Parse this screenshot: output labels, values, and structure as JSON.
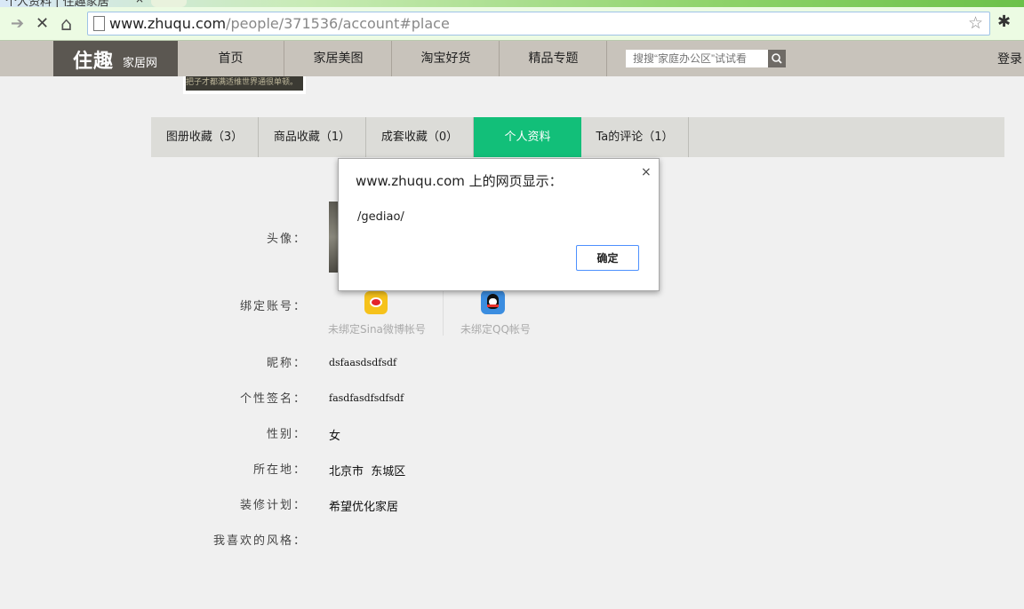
{
  "browser": {
    "tab_title": "个人资料 | 住趣家居",
    "tab_close": "×",
    "url_host": "www.zhuqu.com",
    "url_path": "/people/371536/account#place",
    "back_glyph": "➔",
    "stop_glyph": "✕",
    "home_glyph": "⌂",
    "star_glyph": "☆",
    "ext_glyph": "✱"
  },
  "header": {
    "logo_main": "住趣",
    "logo_sub": "家居网",
    "nav": [
      "首页",
      "家居美图",
      "淘宝好货",
      "精品专题"
    ],
    "search_placeholder": "搜搜“家庭办公区”试试看",
    "login": "登录"
  },
  "thumb_caption": "把子才都满适维世界通很单顿。",
  "profile_tabs": [
    {
      "label": "图册收藏（3）",
      "active": false
    },
    {
      "label": "商品收藏（1）",
      "active": false
    },
    {
      "label": "成套收藏（0）",
      "active": false
    },
    {
      "label": "个人资料",
      "active": true
    },
    {
      "label": "Ta的评论（1）",
      "active": false
    }
  ],
  "profile": {
    "avatar_label": "头像：",
    "bind_label": "绑定账号：",
    "sina_text": "未绑定Sina微博帐号",
    "qq_text": "未绑定QQ帐号",
    "nickname_label": "昵称：",
    "nickname": "dsfaasdsdfsdf",
    "signature_label": "个性签名：",
    "signature": "fasdfasdfsdfsdf",
    "gender_label": "性别：",
    "gender": "女",
    "location_label": "所在地：",
    "location": "北京市  东城区",
    "plan_label": "装修计划：",
    "plan": "希望优化家居",
    "style_label": "我喜欢的风格："
  },
  "dialog": {
    "title": "www.zhuqu.com 上的网页显示：",
    "message": "/gediao/",
    "ok": "确定",
    "close": "×"
  },
  "colors": {
    "accent": "#12bf79",
    "header_bg": "#c8c3bb",
    "logo_bg": "#5b5751"
  }
}
